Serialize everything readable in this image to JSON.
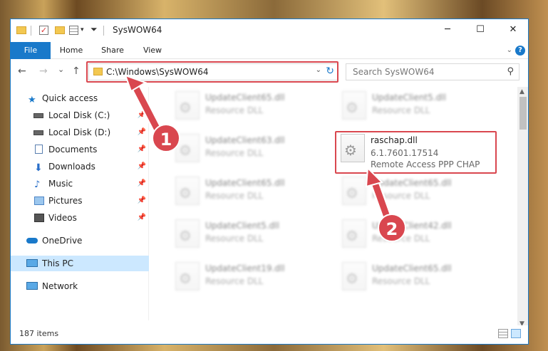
{
  "window": {
    "title": "SysWOW64",
    "controls": {
      "minimize": "─",
      "maximize": "☐",
      "close": "✕"
    }
  },
  "ribbon": {
    "tabs": [
      {
        "label": "File"
      },
      {
        "label": "Home"
      },
      {
        "label": "Share"
      },
      {
        "label": "View"
      }
    ],
    "help": "?"
  },
  "nav": {
    "back": "←",
    "forward": "→",
    "recent": "⌄",
    "up": "↑"
  },
  "address": {
    "path": "C:\\Windows\\SysWOW64",
    "refresh": "↻"
  },
  "search": {
    "placeholder": "Search SysWOW64",
    "icon": "⚲"
  },
  "sidebar": {
    "items": [
      {
        "label": "Quick access",
        "icon": "star-icon",
        "pinned": false
      },
      {
        "label": "Local Disk (C:)",
        "icon": "drive-icon",
        "pinned": true
      },
      {
        "label": "Local Disk (D:)",
        "icon": "drive-icon",
        "pinned": true
      },
      {
        "label": "Documents",
        "icon": "documents-icon",
        "pinned": true
      },
      {
        "label": "Downloads",
        "icon": "download-icon",
        "pinned": true
      },
      {
        "label": "Music",
        "icon": "music-icon",
        "pinned": true
      },
      {
        "label": "Pictures",
        "icon": "pictures-icon",
        "pinned": true
      },
      {
        "label": "Videos",
        "icon": "videos-icon",
        "pinned": true
      },
      {
        "label": "OneDrive",
        "icon": "cloud-icon",
        "pinned": false
      },
      {
        "label": "This PC",
        "icon": "computer-icon",
        "pinned": false,
        "selected": true
      },
      {
        "label": "Network",
        "icon": "network-icon",
        "pinned": false
      }
    ]
  },
  "files": {
    "left": [
      {
        "name": "UpdateClient65.dll",
        "type": "Resource DLL"
      },
      {
        "name": "UpdateClient63.dll",
        "type": "Resource DLL"
      },
      {
        "name": "UpdateClient65.dll",
        "type": "Resource DLL"
      },
      {
        "name": "UpdateClient5.dll",
        "type": "Resource DLL"
      },
      {
        "name": "UpdateClient19.dll",
        "type": "Resource DLL"
      }
    ],
    "right": [
      {
        "name": "UpdateClient5.dll",
        "type": "Resource DLL"
      },
      {
        "name": "UpdateClient65.dll",
        "type": "Resource DLL"
      },
      {
        "name": "UpdateClient42.dll",
        "type": "Resource DLL"
      },
      {
        "name": "UpdateClient65.dll",
        "type": "Resource DLL"
      }
    ],
    "featured": {
      "name": "raschap.dll",
      "version": "6.1.7601.17514",
      "description": "Remote Access PPP CHAP"
    }
  },
  "status": {
    "count": "187 items"
  },
  "callouts": [
    "1",
    "2"
  ],
  "colors": {
    "accent": "#1979ca",
    "highlight": "#d9474f",
    "selected": "#cce8ff"
  }
}
